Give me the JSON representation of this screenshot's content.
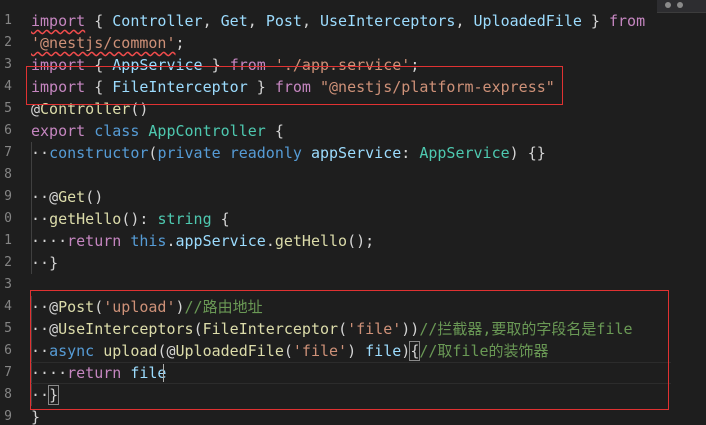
{
  "gutter": {
    "line_numbers": [
      "1",
      "2",
      "3",
      "4",
      "5",
      "6",
      "7",
      "8",
      "9",
      "0",
      "1",
      "2",
      "3",
      "4",
      "5",
      "6",
      "7",
      "8",
      "9"
    ]
  },
  "code": {
    "lines": [
      [
        {
          "t": "import",
          "c": "ctrl",
          "sq": true
        },
        {
          "t": " { "
        },
        {
          "t": "Controller",
          "c": "var"
        },
        {
          "t": ", "
        },
        {
          "t": "Get",
          "c": "var"
        },
        {
          "t": ", "
        },
        {
          "t": "Post",
          "c": "var"
        },
        {
          "t": ", "
        },
        {
          "t": "UseInterceptors",
          "c": "var"
        },
        {
          "t": ", "
        },
        {
          "t": "UploadedFile",
          "c": "var"
        },
        {
          "t": " } "
        },
        {
          "t": "from",
          "c": "ctrl"
        }
      ],
      [
        {
          "t": "'@nestjs/common'",
          "c": "str",
          "sq": true
        },
        {
          "t": ";"
        }
      ],
      [
        {
          "t": "import",
          "c": "ctrl"
        },
        {
          "t": " { "
        },
        {
          "t": "AppService",
          "c": "var"
        },
        {
          "t": " } "
        },
        {
          "t": "from",
          "c": "ctrl"
        },
        {
          "t": " "
        },
        {
          "t": "'./app.service'",
          "c": "str"
        },
        {
          "t": ";"
        }
      ],
      [
        {
          "t": "import",
          "c": "ctrl"
        },
        {
          "t": " { "
        },
        {
          "t": "FileInterceptor",
          "c": "var"
        },
        {
          "t": " } "
        },
        {
          "t": "from",
          "c": "ctrl"
        },
        {
          "t": " "
        },
        {
          "t": "\"@nestjs/platform-express\"",
          "c": "str"
        }
      ],
      [
        {
          "t": "@",
          "c": "punc"
        },
        {
          "t": "Controller",
          "c": "fn"
        },
        {
          "t": "()"
        }
      ],
      [
        {
          "t": "export",
          "c": "ctrl"
        },
        {
          "t": " "
        },
        {
          "t": "class",
          "c": "kw"
        },
        {
          "t": " "
        },
        {
          "t": "AppController",
          "c": "cls"
        },
        {
          "t": " {"
        }
      ],
      [
        {
          "t": "··",
          "c": "ws"
        },
        {
          "t": "constructor",
          "c": "kw"
        },
        {
          "t": "("
        },
        {
          "t": "private",
          "c": "kw"
        },
        {
          "t": " "
        },
        {
          "t": "readonly",
          "c": "kw"
        },
        {
          "t": " "
        },
        {
          "t": "appService",
          "c": "var"
        },
        {
          "t": ": "
        },
        {
          "t": "AppService",
          "c": "cls"
        },
        {
          "t": ") {}"
        }
      ],
      [],
      [
        {
          "t": "··",
          "c": "ws"
        },
        {
          "t": "@",
          "c": "punc"
        },
        {
          "t": "Get",
          "c": "fn"
        },
        {
          "t": "()"
        }
      ],
      [
        {
          "t": "··",
          "c": "ws"
        },
        {
          "t": "getHello",
          "c": "fn"
        },
        {
          "t": "(): "
        },
        {
          "t": "string",
          "c": "cls"
        },
        {
          "t": " {"
        }
      ],
      [
        {
          "t": "····",
          "c": "ws"
        },
        {
          "t": "return",
          "c": "ctrl"
        },
        {
          "t": " "
        },
        {
          "t": "this",
          "c": "kw"
        },
        {
          "t": "."
        },
        {
          "t": "appService",
          "c": "var"
        },
        {
          "t": "."
        },
        {
          "t": "getHello",
          "c": "fn"
        },
        {
          "t": "();"
        }
      ],
      [
        {
          "t": "··",
          "c": "ws"
        },
        {
          "t": "}"
        }
      ],
      [],
      [
        {
          "t": "··",
          "c": "ws"
        },
        {
          "t": "@",
          "c": "punc"
        },
        {
          "t": "Post",
          "c": "fn"
        },
        {
          "t": "("
        },
        {
          "t": "'upload'",
          "c": "str"
        },
        {
          "t": ")"
        },
        {
          "t": "//路由地址",
          "c": "cmt"
        }
      ],
      [
        {
          "t": "··",
          "c": "ws"
        },
        {
          "t": "@",
          "c": "punc"
        },
        {
          "t": "UseInterceptors",
          "c": "fn"
        },
        {
          "t": "("
        },
        {
          "t": "FileInterceptor",
          "c": "fn"
        },
        {
          "t": "("
        },
        {
          "t": "'file'",
          "c": "str"
        },
        {
          "t": "))"
        },
        {
          "t": "//拦截器,要取的字段名是file",
          "c": "cmt"
        }
      ],
      [
        {
          "t": "··",
          "c": "ws"
        },
        {
          "t": "async",
          "c": "kw"
        },
        {
          "t": " "
        },
        {
          "t": "upload",
          "c": "fn"
        },
        {
          "t": "("
        },
        {
          "t": "@",
          "c": "punc"
        },
        {
          "t": "UploadedFile",
          "c": "fn"
        },
        {
          "t": "("
        },
        {
          "t": "'file'",
          "c": "str"
        },
        {
          "t": ") "
        },
        {
          "t": "file",
          "c": "var"
        },
        {
          "t": ")"
        },
        {
          "t": "{",
          "b": true
        },
        {
          "t": "//取file的装饰器",
          "c": "cmt"
        }
      ],
      [
        {
          "t": "····",
          "c": "ws"
        },
        {
          "t": "return",
          "c": "ctrl"
        },
        {
          "t": " "
        },
        {
          "t": "file",
          "c": "var"
        }
      ],
      [
        {
          "t": "··",
          "c": "ws"
        },
        {
          "t": "}",
          "b": true
        }
      ],
      [
        {
          "t": "}"
        }
      ]
    ]
  },
  "colors": {
    "background": "#1e1e1e",
    "highlight_border": "#e03232"
  }
}
